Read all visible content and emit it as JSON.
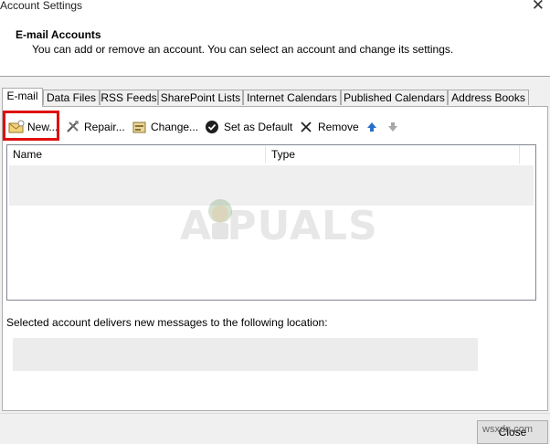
{
  "window": {
    "title": "Account Settings"
  },
  "header": {
    "title": "E-mail Accounts",
    "description": "You can add or remove an account. You can select an account and change its settings."
  },
  "tabs": [
    {
      "label": "E-mail",
      "active": true
    },
    {
      "label": "Data Files"
    },
    {
      "label": "RSS Feeds"
    },
    {
      "label": "SharePoint Lists"
    },
    {
      "label": "Internet Calendars"
    },
    {
      "label": "Published Calendars"
    },
    {
      "label": "Address Books"
    }
  ],
  "toolbar": {
    "new_label": "New...",
    "repair_label": "Repair...",
    "change_label": "Change...",
    "default_label": "Set as Default",
    "remove_label": "Remove",
    "icons": {
      "new": "mail-new-icon",
      "repair": "tools-icon",
      "change": "change-account-icon",
      "default": "checkmark-circle-icon",
      "remove": "x-icon",
      "up": "arrow-up-icon",
      "down": "arrow-down-icon"
    }
  },
  "accounts_table": {
    "columns": [
      "Name",
      "Type"
    ],
    "rows": []
  },
  "location": {
    "label": "Selected account delivers new messages to the following location:",
    "value": ""
  },
  "footer": {
    "close_label": "Close"
  },
  "watermark": {
    "text": "A PUALS",
    "corner": "wsxdn.com"
  },
  "colors": {
    "highlight": "#e01010",
    "panel_bg": "#f0f0f0",
    "row_bg": "#efefef"
  }
}
